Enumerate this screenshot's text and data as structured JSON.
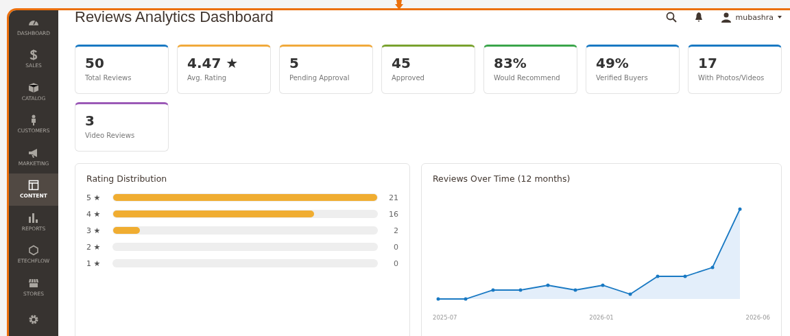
{
  "sidebar": {
    "items": [
      {
        "label": "DASHBOARD",
        "selected": false
      },
      {
        "label": "SALES",
        "selected": false
      },
      {
        "label": "CATALOG",
        "selected": false
      },
      {
        "label": "CUSTOMERS",
        "selected": false
      },
      {
        "label": "MARKETING",
        "selected": false
      },
      {
        "label": "CONTENT",
        "selected": true
      },
      {
        "label": "REPORTS",
        "selected": false
      },
      {
        "label": "ETECHFLOW",
        "selected": false
      },
      {
        "label": "STORES",
        "selected": false
      },
      {
        "selected": false
      }
    ]
  },
  "header": {
    "title": "Reviews Analytics Dashboard",
    "user": "mubashra"
  },
  "stats": [
    {
      "value": "50",
      "label": "Total Reviews",
      "color": "#1979c3"
    },
    {
      "value": "4.47 ★",
      "label": "Avg. Rating",
      "color": "#f0a93b"
    },
    {
      "value": "5",
      "label": "Pending Approval",
      "color": "#f0a93b"
    },
    {
      "value": "45",
      "label": "Approved",
      "color": "#79a22e"
    },
    {
      "value": "83%",
      "label": "Would Recommend",
      "color": "#3aa54a"
    },
    {
      "value": "49%",
      "label": "Verified Buyers",
      "color": "#1979c3"
    },
    {
      "value": "17",
      "label": "With Photos/Videos",
      "color": "#1979c3"
    },
    {
      "value": "3",
      "label": "Video Reviews",
      "color": "#9b59b6"
    }
  ],
  "rating_distribution": {
    "title": "Rating Distribution",
    "rows": [
      {
        "label": "5 ★",
        "level": 1.0,
        "count": "21"
      },
      {
        "label": "4 ★",
        "level": 0.76,
        "count": "16"
      },
      {
        "label": "3 ★",
        "level": 0.1,
        "count": "2"
      },
      {
        "label": "2 ★",
        "count": "0"
      },
      {
        "label": "1 ★",
        "count": "0"
      }
    ]
  },
  "reviews_over_time": {
    "title": "Reviews Over Time (12 months)",
    "x_labels": [
      "2025-07",
      "2026-01",
      "2026-06"
    ]
  }
}
